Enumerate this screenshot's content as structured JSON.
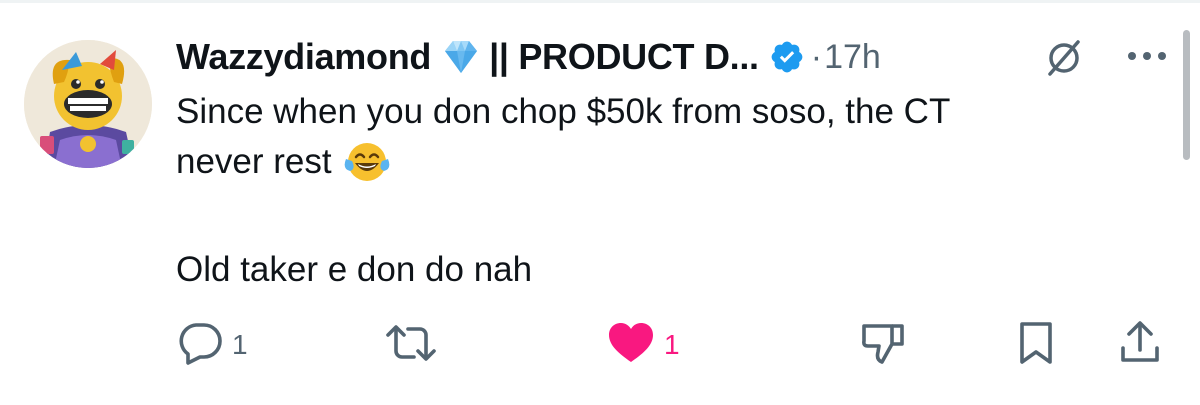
{
  "post": {
    "author_name": "Wazzydiamond",
    "author_title": "|| PRODUCT D...",
    "separator": "·",
    "time": "17h",
    "text_line1": "Since when you don chop $50k from soso, the CT",
    "text_line2": "never rest",
    "text_line3": "Old taker e don do nah"
  },
  "actions": {
    "reply_count": "1",
    "like_count": "1"
  },
  "icons": {
    "verified": "verified-badge-icon",
    "diamond": "blue-diamond-emoji",
    "emoji": "tears-of-joy-emoji",
    "grok": "grok-icon",
    "more": "more-icon",
    "reply": "reply-icon",
    "repost": "repost-icon",
    "like": "heart-icon",
    "dislike": "dislike-icon",
    "bookmark": "bookmark-icon",
    "share": "share-icon"
  },
  "colors": {
    "accent": "#1d9bf0",
    "like": "#f91880",
    "muted": "#536471",
    "text": "#0f1419"
  }
}
